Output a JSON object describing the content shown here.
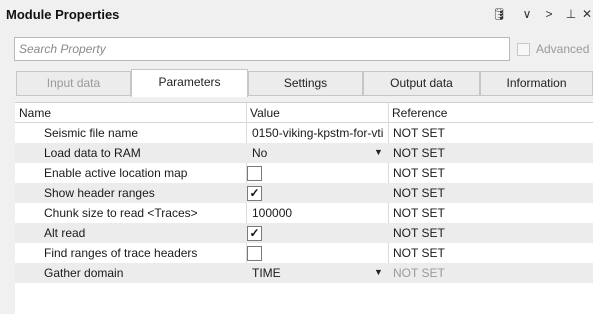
{
  "window": {
    "title": "Module Properties"
  },
  "toolbar": {
    "icons": [
      "database-icon",
      "chevron-down-icon",
      "chevron-right-icon",
      "pin-icon",
      "close-icon"
    ],
    "glyphs": [
      "🛢",
      "∨",
      ">",
      "⊥",
      "✕"
    ]
  },
  "search": {
    "placeholder": "Search Property",
    "value": ""
  },
  "advanced": {
    "label": "Advanced",
    "checked": false
  },
  "tabs": [
    {
      "label": "Input data",
      "state": "disabled"
    },
    {
      "label": "Parameters",
      "state": "active"
    },
    {
      "label": "Settings",
      "state": "normal"
    },
    {
      "label": "Output data",
      "state": "normal"
    },
    {
      "label": "Information",
      "state": "normal"
    }
  ],
  "grid": {
    "headers": {
      "name": "Name",
      "value": "Value",
      "reference": "Reference"
    },
    "rows": [
      {
        "name": "Seismic file name",
        "type": "text",
        "value": "0150-viking-kpstm-for-vti",
        "reference": "NOT SET"
      },
      {
        "name": "Load data to RAM",
        "type": "dropdown",
        "value": "No",
        "reference": "NOT SET"
      },
      {
        "name": "Enable active location map",
        "type": "checkbox",
        "checked": false,
        "reference": "NOT SET"
      },
      {
        "name": "Show header ranges",
        "type": "checkbox",
        "checked": true,
        "reference": "NOT SET"
      },
      {
        "name": "Chunk size to read <Traces>",
        "type": "text",
        "value": "100000",
        "reference": "NOT SET"
      },
      {
        "name": "Alt read",
        "type": "checkbox",
        "checked": true,
        "reference": "NOT SET"
      },
      {
        "name": "Find ranges of trace headers",
        "type": "checkbox",
        "checked": false,
        "reference": "NOT SET"
      },
      {
        "name": "Gather domain",
        "type": "dropdown",
        "value": "TIME",
        "reference": "NOT SET",
        "reference_dimmed": true
      }
    ]
  },
  "colors": {
    "row_alt": "#ececec",
    "background": "#f0f0f0",
    "ref_dimmed": "#9a9a9a"
  }
}
